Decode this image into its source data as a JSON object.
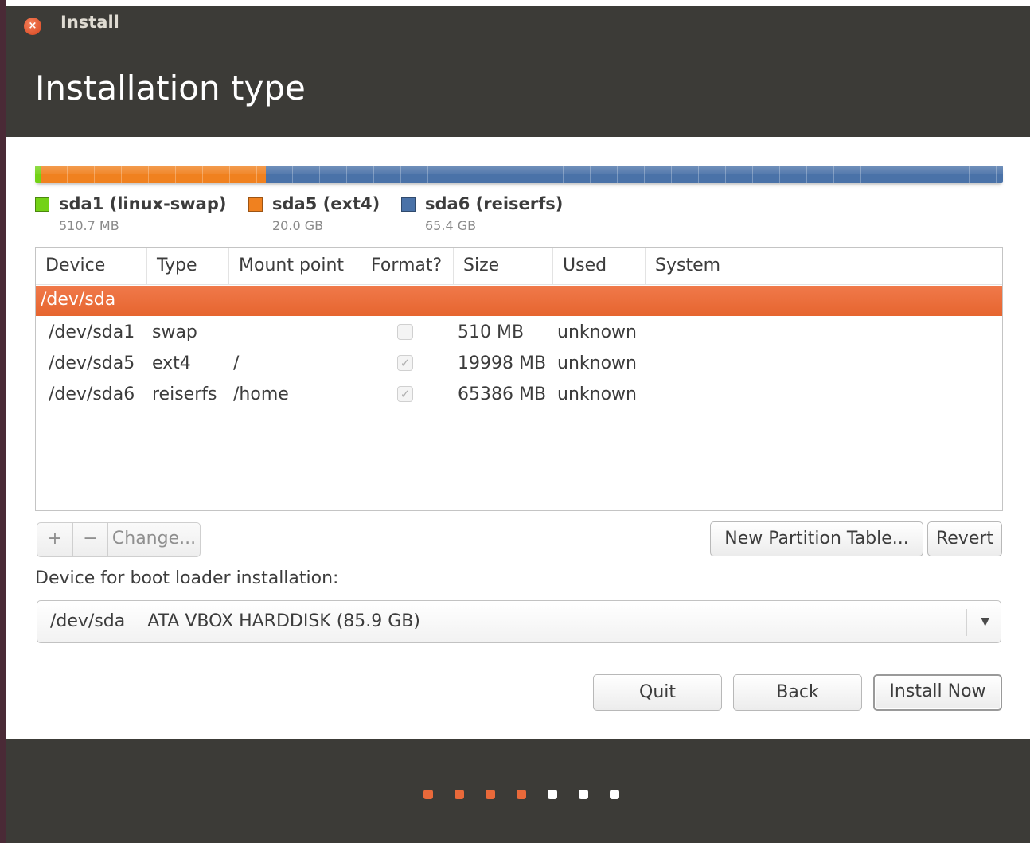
{
  "window": {
    "title": "Install",
    "close_symbol": "×"
  },
  "header": {
    "title": "Installation type"
  },
  "colors": {
    "swap": "#73d216",
    "ext4": "#f0811f",
    "reiserfs": "#4a72a8",
    "selected_row": "#e9693a",
    "progress_done": "#e9693a",
    "progress_todo": "#ffffff"
  },
  "partitions_bar": [
    {
      "name": "sda1 (linux-swap)",
      "size": "510.7 MB",
      "color": "#73d216",
      "fraction": 0.0059
    },
    {
      "name": "sda5 (ext4)",
      "size": "20.0 GB",
      "color": "#f0811f",
      "fraction": 0.2328
    },
    {
      "name": "sda6 (reiserfs)",
      "size": "65.4 GB",
      "color": "#4a72a8",
      "fraction": 0.7613
    }
  ],
  "table": {
    "columns": [
      "Device",
      "Type",
      "Mount point",
      "Format?",
      "Size",
      "Used",
      "System"
    ],
    "disk_row": "/dev/sda",
    "rows": [
      {
        "device": "/dev/sda1",
        "type": "swap",
        "mount": "",
        "format": false,
        "size": "510 MB",
        "used": "unknown",
        "system": ""
      },
      {
        "device": "/dev/sda5",
        "type": "ext4",
        "mount": "/",
        "format": true,
        "size": "19998 MB",
        "used": "unknown",
        "system": ""
      },
      {
        "device": "/dev/sda6",
        "type": "reiserfs",
        "mount": "/home",
        "format": true,
        "size": "65386 MB",
        "used": "unknown",
        "system": ""
      }
    ]
  },
  "toolbar": {
    "add": "+",
    "remove": "−",
    "change": "Change...",
    "new_table": "New Partition Table...",
    "revert": "Revert"
  },
  "boot": {
    "label": "Device for boot loader installation:",
    "value": "/dev/sda    ATA VBOX HARDDISK (85.9 GB)",
    "arrow": "▼"
  },
  "actions": {
    "quit": "Quit",
    "back": "Back",
    "install": "Install Now"
  },
  "progress": {
    "total_steps": 7,
    "completed_steps": 4
  }
}
